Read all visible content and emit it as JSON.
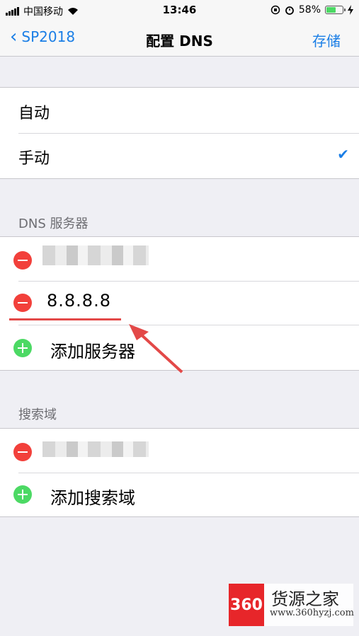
{
  "status_bar": {
    "carrier": "中国移动",
    "time": "13:46",
    "battery_percent": "58%"
  },
  "nav": {
    "back_label": "SP2018",
    "title": "配置 DNS",
    "save_label": "存储"
  },
  "config_mode": {
    "options": [
      {
        "label": "自动"
      },
      {
        "label": "手动",
        "checked": true
      }
    ]
  },
  "dns_section": {
    "header": "DNS 服务器",
    "servers": [
      {
        "value": ""
      },
      {
        "value": "8.8.8.8"
      }
    ],
    "add_label": "添加服务器"
  },
  "search_section": {
    "header": "搜索域",
    "domains": [
      {
        "value": ""
      }
    ],
    "add_label": "添加搜索域"
  },
  "watermark": {
    "logo": "360",
    "title": "货源之家",
    "url": "www.360hyzj.com"
  },
  "colors": {
    "accent": "#1a7ee6",
    "delete": "#f2403b",
    "add": "#4cd964",
    "annotation": "#e34948"
  }
}
